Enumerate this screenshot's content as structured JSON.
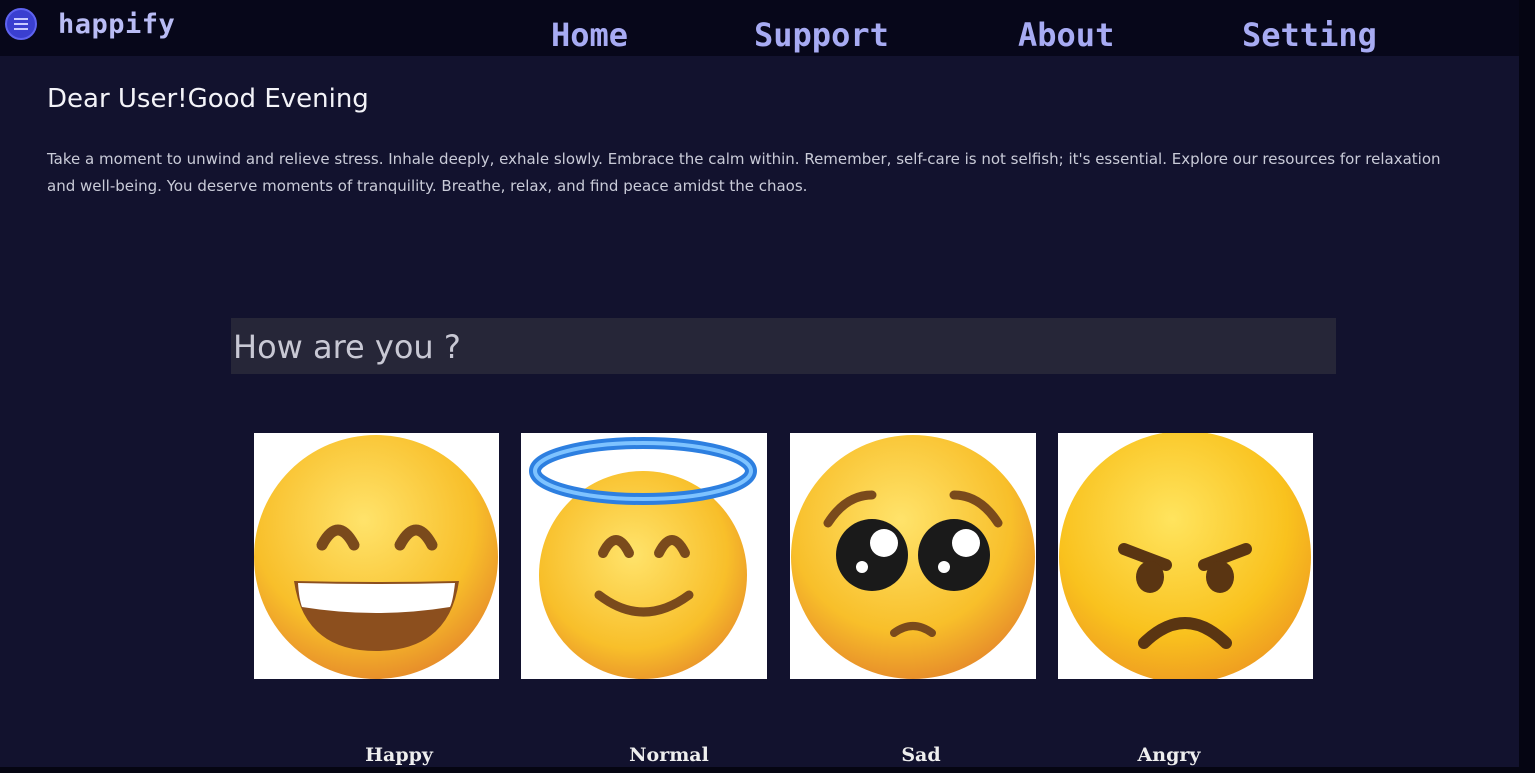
{
  "app": {
    "brand": "happify",
    "logo_icon": "list-circle-icon"
  },
  "nav": {
    "items": [
      {
        "label": "Home"
      },
      {
        "label": "Support"
      },
      {
        "label": "About"
      },
      {
        "label": "Setting"
      }
    ]
  },
  "greeting": {
    "title": "Dear User!Good Evening",
    "message": "Take a moment to unwind and relieve stress. Inhale deeply, exhale slowly. Embrace the calm within. Remember, self-care is not selfish; it's essential. Explore our resources for relaxation and well-being. You deserve moments of tranquility. Breathe, relax, and find peace amidst the chaos."
  },
  "mood": {
    "prompt": "How are you ?",
    "options": [
      {
        "label": "Happy",
        "icon": "grinning-face-icon"
      },
      {
        "label": "Normal",
        "icon": "smiling-face-with-halo-icon"
      },
      {
        "label": "Sad",
        "icon": "pleading-face-icon"
      },
      {
        "label": "Angry",
        "icon": "angry-face-icon"
      }
    ]
  },
  "colors": {
    "background": "#12122e",
    "navbar": "#07071a",
    "nav_link": "#a7abf3",
    "prompt_bar": "#262638",
    "emoji_yellow": "#fbc02d"
  }
}
